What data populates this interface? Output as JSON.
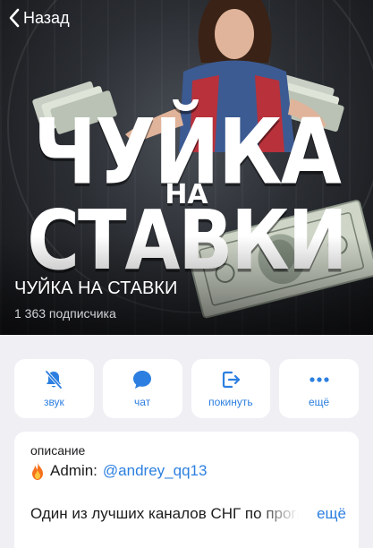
{
  "nav": {
    "back_label": "Назад"
  },
  "hero": {
    "logo_line1": "ЧУЙКА",
    "logo_line2": "НА",
    "logo_line3": "СТАВКИ"
  },
  "channel": {
    "name": "ЧУЙКА НА СТАВКИ",
    "subscribers": "1 363 подписчика"
  },
  "actions": [
    {
      "label": "звук",
      "icon": "bell-off-icon"
    },
    {
      "label": "чат",
      "icon": "chat-bubble-icon"
    },
    {
      "label": "покинуть",
      "icon": "leave-icon"
    },
    {
      "label": "ещё",
      "icon": "more-dots-icon"
    }
  ],
  "description": {
    "title": "описание",
    "admin_prefix": "Admin:",
    "admin_handle": "@andrey_qq13",
    "text": "Один из лучших каналов СНГ по прогнозам",
    "more_label": "ещё"
  },
  "colors": {
    "accent": "#2c7fe0",
    "background": "#efeff4",
    "card": "#ffffff"
  }
}
